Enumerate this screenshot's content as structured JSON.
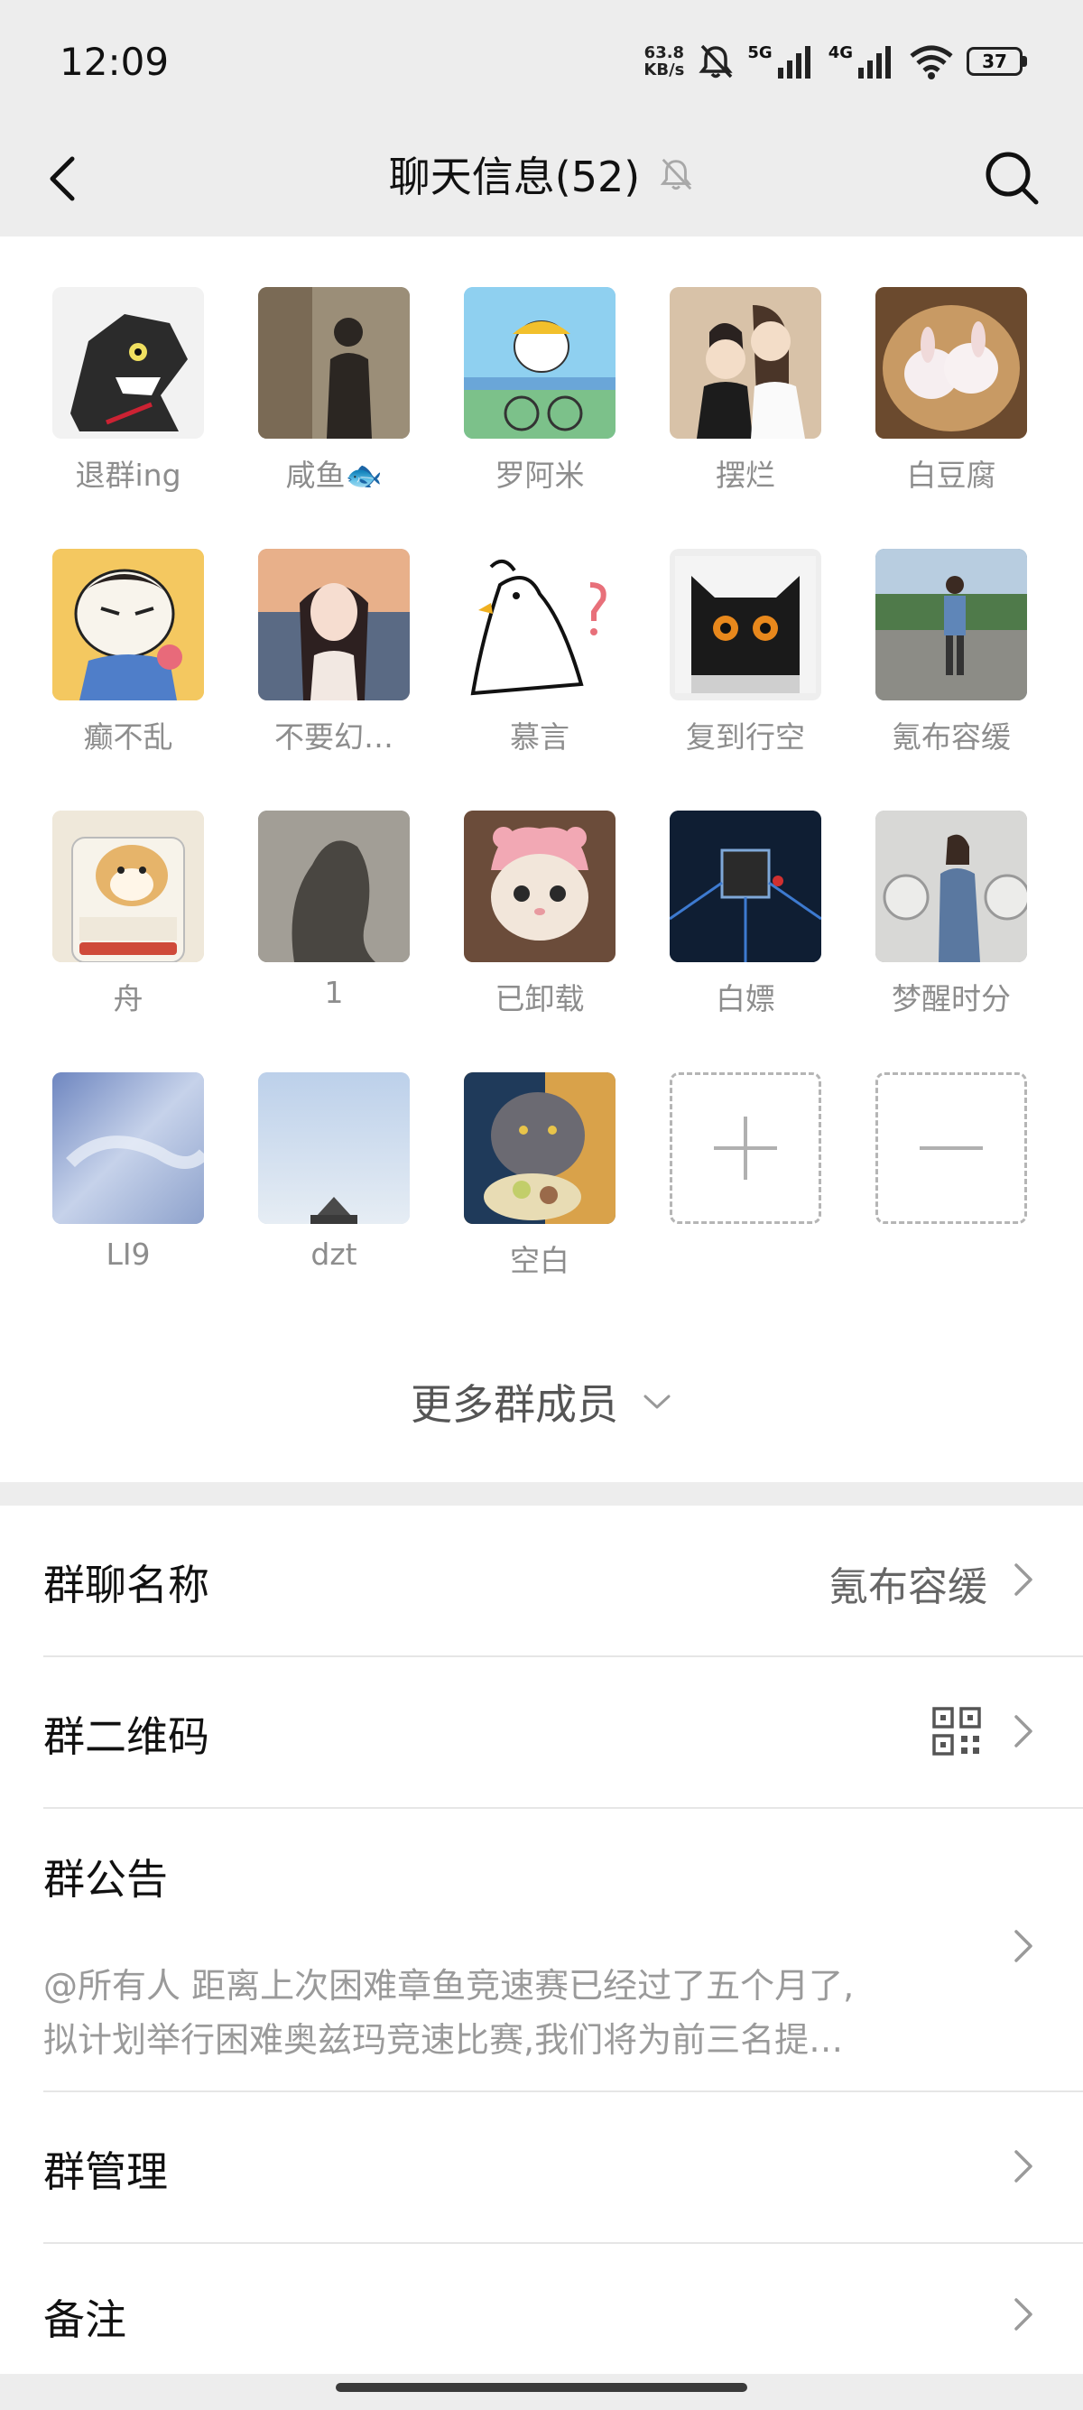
{
  "status_bar": {
    "time": "12:09",
    "net_speed_value": "63.8",
    "net_speed_unit": "KB/s",
    "signal_1_label": "5G",
    "signal_2_label": "4G",
    "battery": "37",
    "icons": [
      "mute-bell-icon",
      "signal-icon",
      "wifi-icon",
      "battery-icon"
    ]
  },
  "nav": {
    "title": "聊天信息(52)",
    "back_icon": "chevron-left-icon",
    "mute_icon": "bell-off-icon",
    "search_icon": "search-icon"
  },
  "members": [
    {
      "name": "退群ing",
      "avatar_color": "#2b2b2b"
    },
    {
      "name": "咸鱼🐟",
      "avatar_color": "#8a7d6b"
    },
    {
      "name": "罗阿米",
      "avatar_color": "#7ec4e8"
    },
    {
      "name": "摆烂",
      "avatar_color": "#caa58a"
    },
    {
      "name": "白豆腐",
      "avatar_color": "#b88a5e"
    },
    {
      "name": "癫不乱",
      "avatar_color": "#f0c05a"
    },
    {
      "name": "不要幻…",
      "avatar_color": "#c79a86"
    },
    {
      "name": "慕言",
      "avatar_color": "#ffffff"
    },
    {
      "name": "复到行空",
      "avatar_color": "#3b3b3b"
    },
    {
      "name": "氪布容缓",
      "avatar_color": "#6f8ea3"
    },
    {
      "name": "舟",
      "avatar_color": "#e8d9b8"
    },
    {
      "name": "1",
      "avatar_color": "#7a7670"
    },
    {
      "name": "已卸载",
      "avatar_color": "#c79a7a"
    },
    {
      "name": "白嫖",
      "avatar_color": "#1b2f4a"
    },
    {
      "name": "梦醒时分",
      "avatar_color": "#a5a5a5"
    },
    {
      "name": "LI9",
      "avatar_color": "#9fb4d6"
    },
    {
      "name": "dzt",
      "avatar_color": "#c9d8ea"
    },
    {
      "name": "空白",
      "avatar_color": "#6c6a70"
    }
  ],
  "actions": {
    "add_icon": "plus-icon",
    "remove_icon": "minus-icon"
  },
  "more_members": {
    "label": "更多群成员",
    "icon": "chevron-down-icon"
  },
  "settings": {
    "group_name_label": "群聊名称",
    "group_name_value": "氪布容缓",
    "qr_label": "群二维码",
    "qr_icon": "qr-code-icon",
    "notice_label": "群公告",
    "notice_line1": "@所有人 距离上次困难章鱼竞速赛已经过了五个月了,",
    "notice_line2": "拟计划举行困难奥兹玛竞速比赛,我们将为前三名提…",
    "manage_label": "群管理",
    "remark_label": "备注",
    "chevron_icon": "chevron-right-icon"
  }
}
